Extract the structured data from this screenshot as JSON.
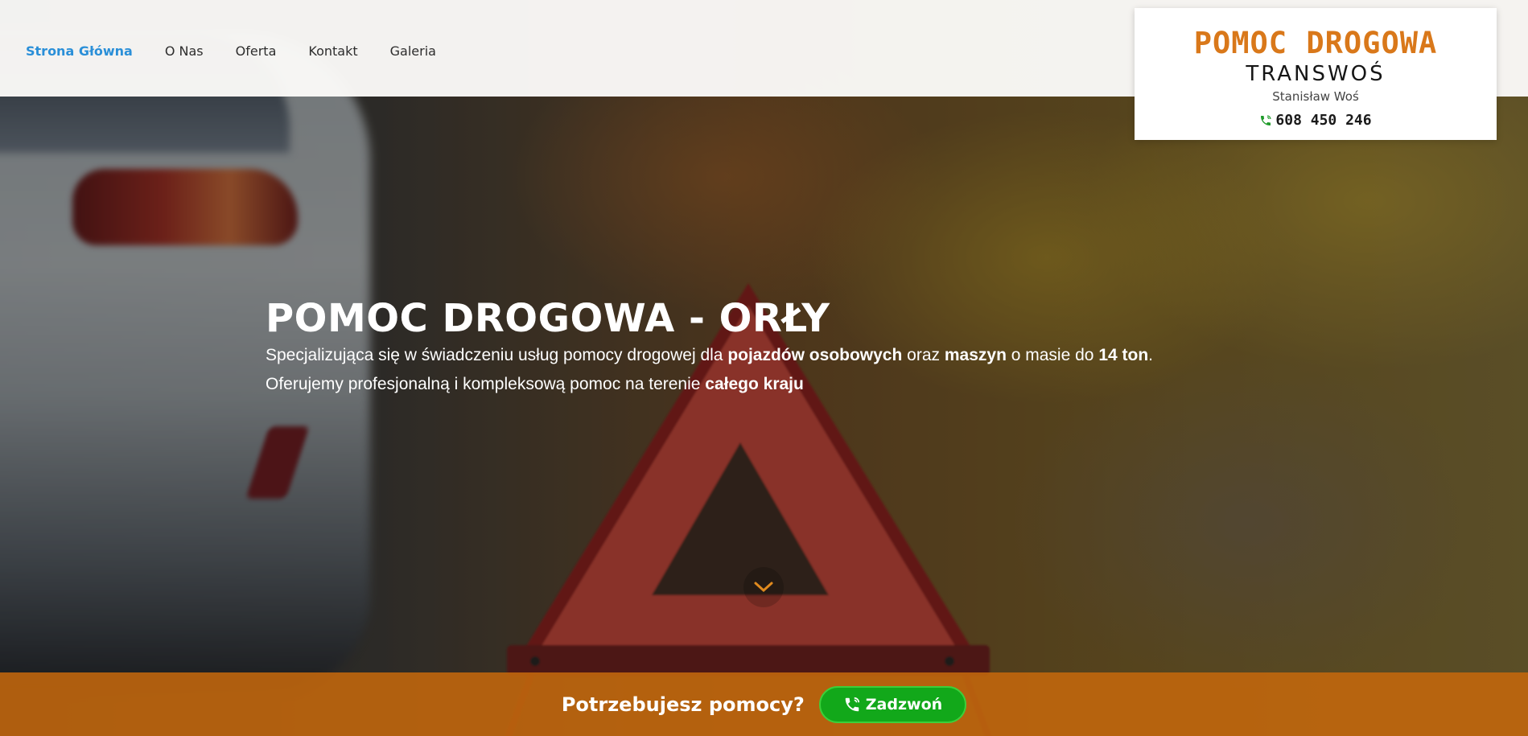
{
  "nav": {
    "items": [
      {
        "label": "Strona Główna",
        "active": true
      },
      {
        "label": "O Nas",
        "active": false
      },
      {
        "label": "Oferta",
        "active": false
      },
      {
        "label": "Kontakt",
        "active": false
      },
      {
        "label": "Galeria",
        "active": false
      }
    ]
  },
  "logo": {
    "title": "POMOC DROGOWA",
    "subtitle": "TRANSWOŚ",
    "owner": "Stanisław Woś",
    "phone": "608 450 246",
    "phone_icon": "phone-icon"
  },
  "hero": {
    "title": "POMOC DROGOWA - ORŁY",
    "line1": {
      "t1": "Specjalizująca się w świadczeniu usług pomocy drogowej dla ",
      "b1": "pojazdów osobowych",
      "t2": " oraz ",
      "b2": "maszyn",
      "t3": " o masie do ",
      "b3": "14 ton",
      "t4": "."
    },
    "line2": {
      "t1": "Oferujemy profesjonalną i kompleksową pomoc na terenie ",
      "b1": "całego kraju"
    },
    "scroll_icon": "chevron-down-icon"
  },
  "cta": {
    "question": "Potrzebujesz pomocy?",
    "button_label": "Zadzwoń",
    "button_icon": "phone-call-icon"
  },
  "colors": {
    "accent_orange": "#d9781a",
    "nav_active": "#2a8fd8",
    "cta_bar": "#c4680c",
    "call_button": "#12a81a"
  }
}
